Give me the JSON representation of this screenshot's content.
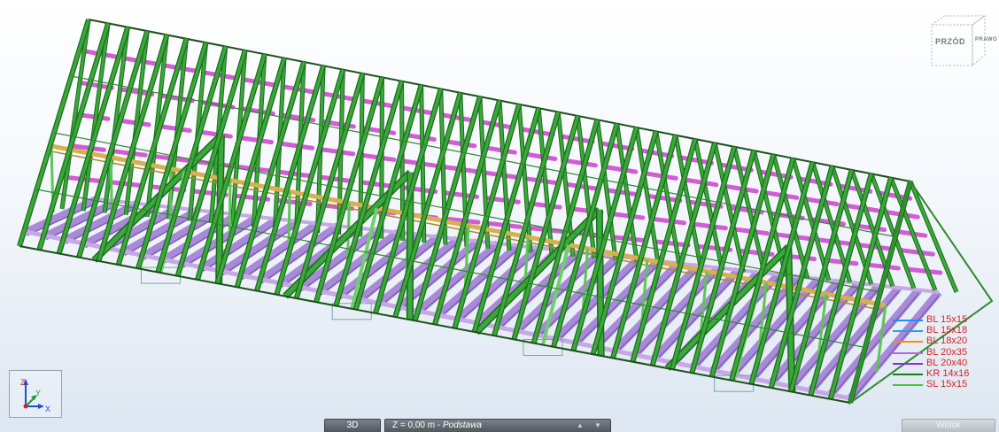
{
  "viewcube": {
    "front_label": "PRZÓD",
    "right_label": "PRAWO"
  },
  "legend": [
    {
      "label": "BL 15x15",
      "line_color": "#1e8cff",
      "text_color": "#e02020"
    },
    {
      "label": "BL 15x18",
      "line_color": "#22a0e8",
      "text_color": "#e02020"
    },
    {
      "label": "BL 18x20",
      "line_color": "#ff8c00",
      "text_color": "#e02020"
    },
    {
      "label": "BL 20x35",
      "line_color": "#c060e0",
      "text_color": "#e02020"
    },
    {
      "label": "BL 20x40",
      "line_color": "#8a2be2",
      "text_color": "#e02020"
    },
    {
      "label": "KR 14x16",
      "line_color": "#1f7a1f",
      "text_color": "#e02020"
    },
    {
      "label": "SL 15x15",
      "line_color": "#46c43a",
      "text_color": "#e02020"
    }
  ],
  "axes": {
    "z": "Z",
    "y": "Y",
    "x": "X"
  },
  "statusbar": {
    "view_tab": "3D",
    "level_prefix": "Z = 0,00 m - ",
    "level_name": "Podstawa",
    "right_tab": "Widok"
  },
  "colors": {
    "rafter": "#3aa83a",
    "rafter_edge": "#1d6b1d",
    "purlin": "#d05cd6",
    "beam": "#a98ad8",
    "ridge_beam": "#d8b050",
    "sky_top": "#ffffff",
    "sky_bottom": "#dde6f1"
  }
}
